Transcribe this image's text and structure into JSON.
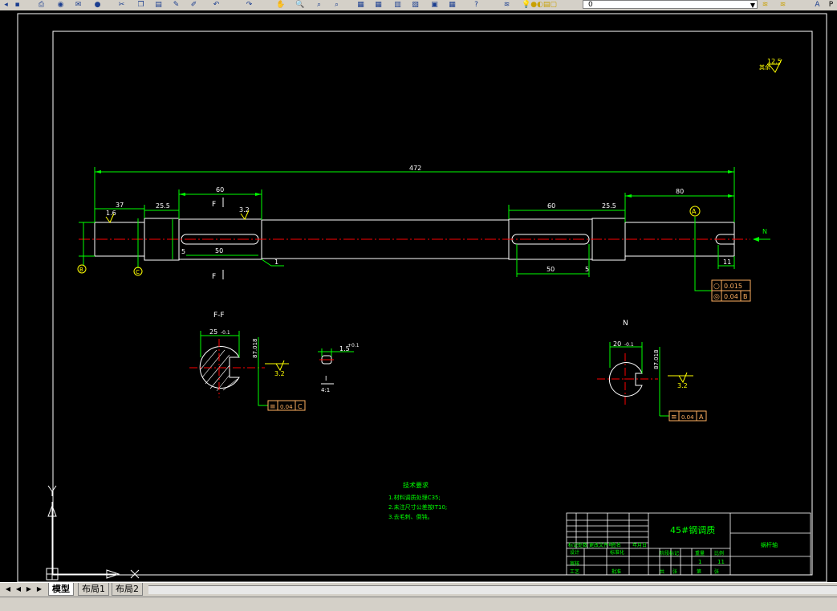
{
  "toolbar": {
    "icons": [
      "undo-icon",
      "save-icon",
      "print-icon",
      "preview-icon",
      "publish-icon",
      "plot-icon",
      "cut-icon",
      "copy-icon",
      "paste-icon",
      "match-properties-icon",
      "block-editor-icon",
      "undo-arrow-icon",
      "redo-arrow-icon",
      "pan-icon",
      "zoom-realtime-icon",
      "zoom-window-icon",
      "zoom-previous-icon",
      "properties-icon",
      "design-center-icon",
      "tool-palettes-icon",
      "sheet-set-icon",
      "markup-icon",
      "calculator-icon",
      "help-icon",
      "layer-manager-icon",
      "layer-state-icons"
    ],
    "layer_value": "0",
    "right_icon": "text-style-icon",
    "right_text": "P"
  },
  "drawing": {
    "roughness_corner": "12.5",
    "roughness_prefix": "其余",
    "dims": {
      "overall": "472",
      "left_37": "37",
      "left_25_5": "25.5",
      "keyseat_left_60": "60",
      "keyseat_left_50": "50",
      "keyseat_left_5": "5",
      "keyseat_right_60": "60",
      "keyseat_right_25_5": "25.5",
      "right_80": "80",
      "keyseat_right_50": "50",
      "keyseat_right_5": "5",
      "right_11": "11",
      "rough_1_6": "1.6",
      "rough_3_2": "3.2",
      "leader_1": "1"
    },
    "section_labels": {
      "f_top": "F",
      "f_bottom": "F",
      "n_arrow": "N",
      "datum_a": "A",
      "datum_b": "B",
      "datum_c": "C"
    },
    "tolerance_frames": [
      {
        "symbol": "○",
        "value": "0.015",
        "datum": ""
      },
      {
        "symbol": "◎",
        "value": "0.04",
        "datum": "B"
      }
    ],
    "section_ff": {
      "title": "F-F",
      "width_dim": "25",
      "width_tol": "-0.1",
      "depth_dim": "87.018",
      "roughness": "3.2",
      "tolerance": {
        "symbol": "≡",
        "value": "0.04",
        "datum": "C"
      }
    },
    "detail_i": {
      "dim": "1.5",
      "tol": "+0.1",
      "label": "I",
      "scale": "4:1"
    },
    "section_n": {
      "title": "N",
      "width_dim": "20",
      "width_tol": "-0.1",
      "depth_dim": "87.018",
      "roughness": "3.2",
      "tolerance": {
        "symbol": "≡",
        "value": "0.04",
        "datum": "A"
      }
    },
    "tech_req": {
      "title": "技术要求",
      "lines": [
        "1.材料调质处理C35;",
        "2.未注尺寸公差按IT10;",
        "3.去毛刺、倒钝。"
      ]
    },
    "title_block": {
      "material": "45#钢调质",
      "part_name": "蜗杆轴",
      "scale": "1",
      "sheet": "11",
      "row_labels": [
        "标记",
        "处数",
        "分区",
        "更改文件号",
        "签名",
        "年月日"
      ],
      "row_labels2": [
        "设计",
        "标准化",
        "阶段标记",
        "重量",
        "比例"
      ],
      "row_labels3": [
        "审核",
        "",
        "工艺",
        "批准",
        "共",
        "张",
        "第",
        "张"
      ]
    }
  },
  "ucs": {
    "x": "X",
    "y": "Y"
  },
  "tabs": [
    "模型",
    "布局1",
    "布局2"
  ],
  "colors": {
    "background": "#000000",
    "green": "#00ff00",
    "red": "#ff0000",
    "white": "#ffffff",
    "yellow": "#ffff00",
    "cyan": "#00ffff",
    "tolerance": "#ffb060"
  }
}
